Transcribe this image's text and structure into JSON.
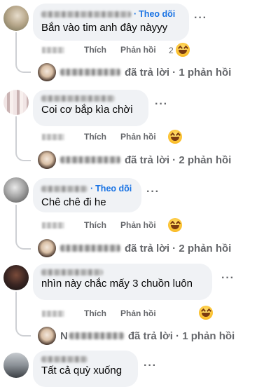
{
  "comments": [
    {
      "follow_label": "Theo dõi",
      "separator": "·",
      "text": "Bắn vào tim anh đây nàyyy",
      "more": "···",
      "like": "Thích",
      "reply": "Phản hồi",
      "reaction_count": "2",
      "reply_summary": "đã trả lời · 1 phản hồi",
      "reply_prefix": ""
    },
    {
      "follow_label": "",
      "separator": "",
      "text": "Coi cơ bắp kìa chời",
      "more": "···",
      "like": "Thích",
      "reply": "Phản hồi",
      "reaction_count": "",
      "reply_summary": "đã trả lời · 2 phản hồi",
      "reply_prefix": ""
    },
    {
      "follow_label": "Theo dõi",
      "separator": "·",
      "text": "Chê chê đi he",
      "more": "···",
      "like": "Thích",
      "reply": "Phản hồi",
      "reaction_count": "",
      "reply_summary": "đã trả lời · 2 phản hồi",
      "reply_prefix": ""
    },
    {
      "follow_label": "",
      "separator": "",
      "text": "nhìn này chắc mấy 3 chuồn luôn",
      "more": "···",
      "like": "Thích",
      "reply": "Phản hồi",
      "reaction_count": "",
      "reply_summary": "đã trả lời · 1 phản hồi",
      "reply_prefix": "N"
    },
    {
      "follow_label": "",
      "separator": "",
      "text": "Tất cả quỳ xuống",
      "more": "···"
    }
  ],
  "colors": {
    "bubble": "#f0f2f5",
    "follow": "#1b74e4",
    "meta": "#65676b"
  },
  "icons": {
    "reaction": "haha-emoji-icon",
    "more": "more-options-icon"
  }
}
